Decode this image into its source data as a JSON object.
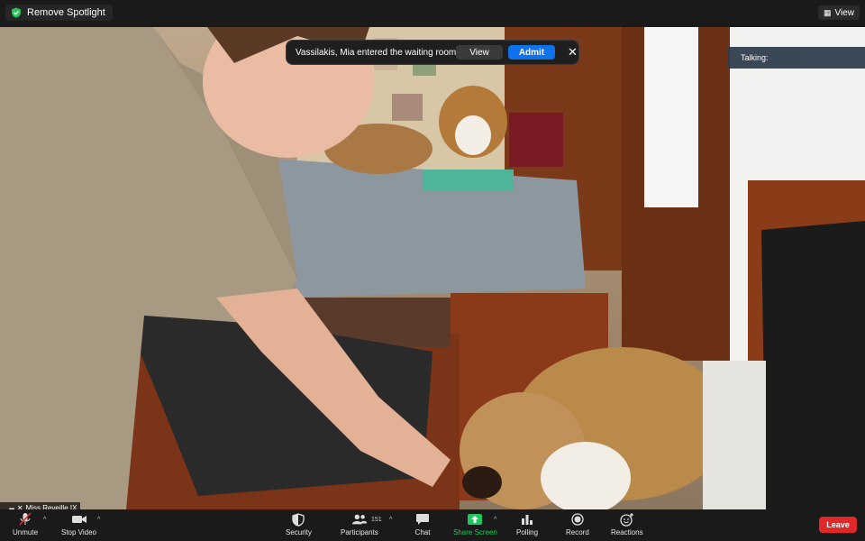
{
  "topbar": {
    "spotlight_label": "Remove Spotlight",
    "view_label": "View"
  },
  "notification": {
    "message": "Vassilakis, Mia entered the waiting room",
    "view_label": "View",
    "admit_label": "Admit",
    "close_label": "✕"
  },
  "talking_panel": {
    "label": "Talking:"
  },
  "participant": {
    "name": "Miss Reveille IX"
  },
  "toolbar": {
    "unmute": "Unmute",
    "stop_video": "Stop Video",
    "security": "Security",
    "participants": "Participants",
    "participants_count": "151",
    "chat": "Chat",
    "share_screen": "Share Screen",
    "polling": "Polling",
    "record": "Record",
    "reactions": "Reactions",
    "leave": "Leave"
  },
  "colors": {
    "toolbar_bg": "#1a1a1a",
    "admit_blue": "#0e72ed",
    "leave_red": "#e02828",
    "share_green": "#23c55e",
    "shield_green": "#23c55e"
  }
}
